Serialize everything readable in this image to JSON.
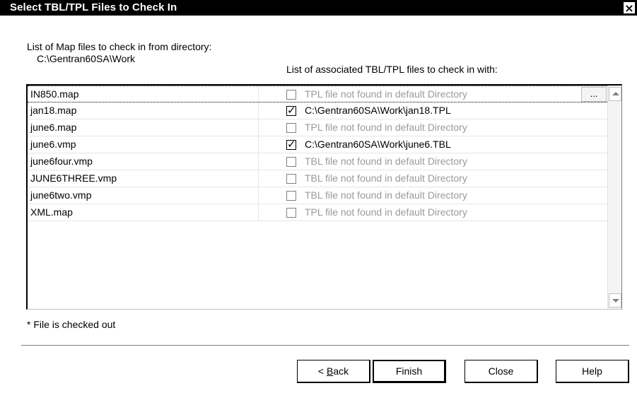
{
  "window": {
    "title": "Select TBL/TPL Files to Check In",
    "close_glyph": "×"
  },
  "labels": {
    "map_list": "List of Map files to check in from directory:",
    "directory": "C:\\Gentran60SA\\Work",
    "assoc_list": "List of associated TBL/TPL files to check in with:"
  },
  "rows": [
    {
      "name": "IN850.map",
      "checked": false,
      "assoc": "TPL file not found in default Directory",
      "missing": true
    },
    {
      "name": "jan18.map",
      "checked": true,
      "assoc": "C:\\Gentran60SA\\Work\\jan18.TPL",
      "missing": false
    },
    {
      "name": "june6.map",
      "checked": false,
      "assoc": "TPL file not found in default Directory",
      "missing": true
    },
    {
      "name": "june6.vmp",
      "checked": true,
      "assoc": "C:\\Gentran60SA\\Work\\june6.TBL",
      "missing": false
    },
    {
      "name": "june6four.vmp",
      "checked": false,
      "assoc": "TBL file not found in default Directory",
      "missing": true
    },
    {
      "name": "JUNE6THREE.vmp",
      "checked": false,
      "assoc": "TBL file not found in default Directory",
      "missing": true
    },
    {
      "name": "june6two.vmp",
      "checked": false,
      "assoc": "TBL file not found in default Directory",
      "missing": true
    },
    {
      "name": "XML.map",
      "checked": false,
      "assoc": "TPL file not found in default Directory",
      "missing": true
    }
  ],
  "browse_label": "...",
  "note": "* File is checked out",
  "buttons": {
    "back_mnemonic": "B",
    "back_rest": "ack",
    "back_prefix": "< ",
    "finish": "Finish",
    "close": "Close",
    "help": "Help"
  },
  "colors": {
    "titlebar": "#000000",
    "missing_text": "#9a9a9a"
  }
}
